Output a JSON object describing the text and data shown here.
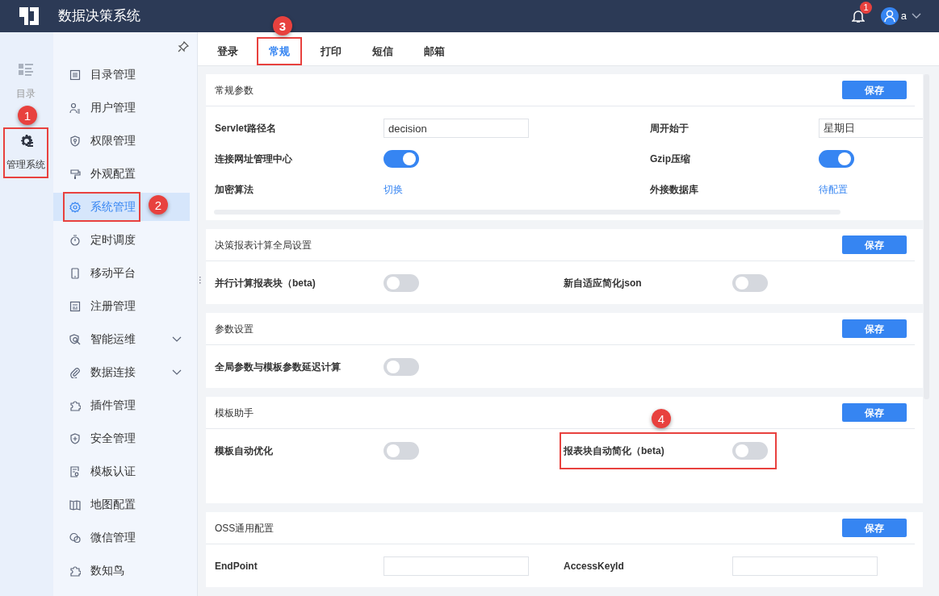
{
  "topbar": {
    "title": "数据决策系统",
    "notifications": "1",
    "user": "a"
  },
  "rail": [
    {
      "label": "目录",
      "selected": false
    },
    {
      "label": "管理系统",
      "selected": true,
      "callout": "1"
    }
  ],
  "sidebar": {
    "items": [
      {
        "label": "目录管理",
        "kind": "page",
        "selected": false
      },
      {
        "label": "用户管理",
        "kind": "page",
        "selected": false
      },
      {
        "label": "权限管理",
        "kind": "page",
        "selected": false
      },
      {
        "label": "外观配置",
        "kind": "page",
        "selected": false
      },
      {
        "label": "系统管理",
        "kind": "page",
        "selected": true,
        "callout": "2"
      },
      {
        "label": "定时调度",
        "kind": "page",
        "selected": false
      },
      {
        "label": "移动平台",
        "kind": "page",
        "selected": false
      },
      {
        "label": "注册管理",
        "kind": "page",
        "selected": false
      },
      {
        "label": "智能运维",
        "kind": "group",
        "selected": false,
        "expanded": false
      },
      {
        "label": "数据连接",
        "kind": "group",
        "selected": false,
        "expanded": false
      },
      {
        "label": "插件管理",
        "kind": "page",
        "selected": false
      },
      {
        "label": "安全管理",
        "kind": "page",
        "selected": false
      },
      {
        "label": "模板认证",
        "kind": "page",
        "selected": false
      },
      {
        "label": "地图配置",
        "kind": "page",
        "selected": false
      },
      {
        "label": "微信管理",
        "kind": "page",
        "selected": false
      },
      {
        "label": "数知鸟",
        "kind": "page",
        "selected": false
      }
    ]
  },
  "tabs": [
    {
      "label": "登录",
      "selected": false
    },
    {
      "label": "常规",
      "selected": true,
      "callout": "3"
    },
    {
      "label": "打印",
      "selected": false
    },
    {
      "label": "短信",
      "selected": false
    },
    {
      "label": "邮箱",
      "selected": false
    }
  ],
  "panels": [
    {
      "title": "常规参数",
      "save": "保存",
      "rows": [
        [
          {
            "label": "Servlet路径名",
            "kind": "input",
            "value": "decision"
          },
          {
            "label": "周开始于",
            "kind": "input",
            "value": "星期日"
          }
        ],
        [
          {
            "label": "连接网址管理中心",
            "kind": "toggle",
            "on": true
          },
          {
            "label": "Gzip压缩",
            "kind": "toggle",
            "on": true
          }
        ],
        [
          {
            "label": "加密算法",
            "kind": "link",
            "value": "切换"
          },
          {
            "label": "外接数据库",
            "kind": "link",
            "value": "待配置"
          }
        ]
      ]
    },
    {
      "title": "决策报表计算全局设置",
      "save": "保存",
      "rows": [
        [
          {
            "label": "并行计算报表块（beta)",
            "kind": "toggle",
            "on": false
          },
          {
            "label": "新自适应简化json",
            "kind": "toggle",
            "on": false
          }
        ]
      ]
    },
    {
      "title": "参数设置",
      "save": "保存",
      "rows": [
        [
          {
            "label": "全局参数与模板参数延迟计算",
            "kind": "toggle",
            "on": false
          }
        ]
      ]
    },
    {
      "title": "模板助手",
      "save": "保存",
      "rows": [
        [
          {
            "label": "模板自动优化",
            "kind": "toggle",
            "on": false
          },
          {
            "label": "报表块自动简化（beta)",
            "kind": "toggle",
            "on": false,
            "callout": "4"
          }
        ]
      ]
    },
    {
      "title": "OSS通用配置",
      "save": "保存",
      "rows": [
        [
          {
            "label": "EndPoint",
            "kind": "input"
          },
          {
            "label": "AccessKeyId",
            "kind": "input"
          }
        ]
      ]
    }
  ]
}
